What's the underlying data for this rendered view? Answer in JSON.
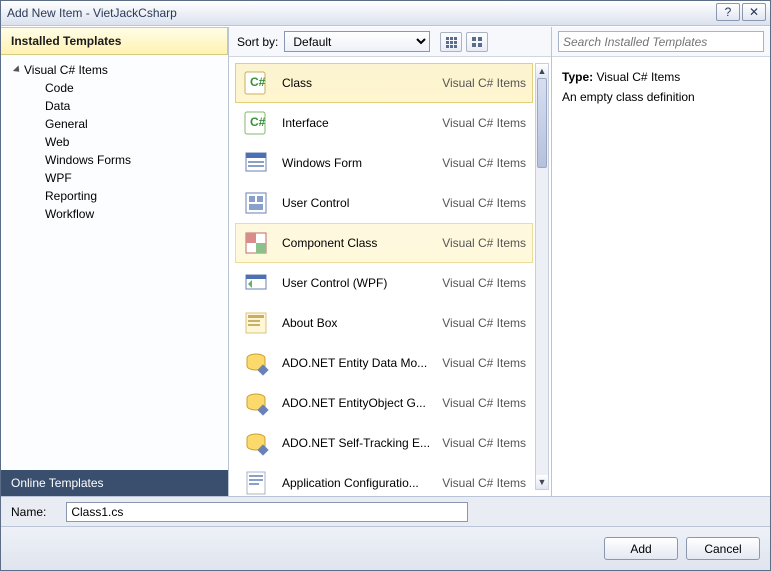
{
  "window": {
    "title": "Add New Item - VietJackCsharp",
    "help_glyph": "?",
    "close_glyph": "✕"
  },
  "left": {
    "installed_header": "Installed Templates",
    "root": "Visual C# Items",
    "children": [
      "Code",
      "Data",
      "General",
      "Web",
      "Windows Forms",
      "WPF",
      "Reporting",
      "Workflow"
    ],
    "online": "Online Templates"
  },
  "sortbar": {
    "label": "Sort by:",
    "value": "Default"
  },
  "items": [
    {
      "name": "Class",
      "cat": "Visual C# Items",
      "icon": "class",
      "state": "selected"
    },
    {
      "name": "Interface",
      "cat": "Visual C# Items",
      "icon": "interface"
    },
    {
      "name": "Windows Form",
      "cat": "Visual C# Items",
      "icon": "form"
    },
    {
      "name": "User Control",
      "cat": "Visual C# Items",
      "icon": "usercontrol"
    },
    {
      "name": "Component Class",
      "cat": "Visual C# Items",
      "icon": "component",
      "state": "hover"
    },
    {
      "name": "User Control (WPF)",
      "cat": "Visual C# Items",
      "icon": "usercontrolwpf"
    },
    {
      "name": "About Box",
      "cat": "Visual C# Items",
      "icon": "aboutbox"
    },
    {
      "name": "ADO.NET Entity Data Mo...",
      "cat": "Visual C# Items",
      "icon": "ado"
    },
    {
      "name": "ADO.NET EntityObject G...",
      "cat": "Visual C# Items",
      "icon": "ado"
    },
    {
      "name": "ADO.NET Self-Tracking E...",
      "cat": "Visual C# Items",
      "icon": "ado"
    },
    {
      "name": "Application Configuratio...",
      "cat": "Visual C# Items",
      "icon": "config"
    }
  ],
  "right": {
    "search_placeholder": "Search Installed Templates",
    "type_label": "Type:",
    "type_value": "Visual C# Items",
    "description": "An empty class definition"
  },
  "namebar": {
    "label": "Name:",
    "value": "Class1.cs"
  },
  "footer": {
    "add": "Add",
    "cancel": "Cancel"
  }
}
